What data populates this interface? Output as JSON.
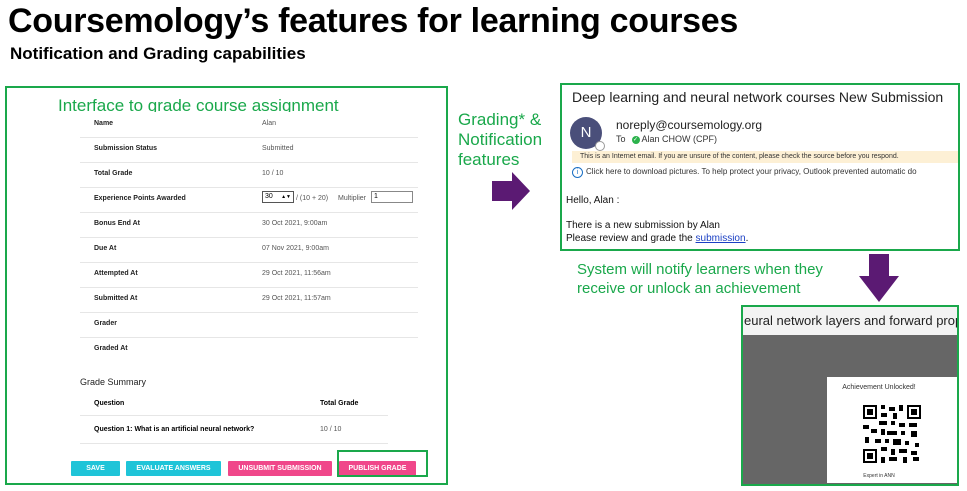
{
  "title": "Coursemology’s features for learning courses",
  "subtitle": "Notification and Grading capabilities",
  "grading_panel": {
    "caption": "Interface to grade course assignment",
    "fields": [
      {
        "label": "Name",
        "value": "Alan"
      },
      {
        "label": "Submission Status",
        "value": "Submitted"
      },
      {
        "label": "Total Grade",
        "value": "10 / 10"
      },
      {
        "label": "Experience Points Awarded",
        "value": ""
      },
      {
        "label": "Bonus End At",
        "value": "30 Oct 2021, 9:00am"
      },
      {
        "label": "Due At",
        "value": "07 Nov 2021, 9:00am"
      },
      {
        "label": "Attempted At",
        "value": "29 Oct 2021, 11:56am"
      },
      {
        "label": "Submitted At",
        "value": "29 Oct 2021, 11:57am"
      },
      {
        "label": "Grader",
        "value": ""
      },
      {
        "label": "Graded At",
        "value": ""
      }
    ],
    "xp_input_value": "30",
    "xp_formula": "/ (10 + 20)",
    "multiplier_label": "Multiplier",
    "multiplier_value": "1",
    "grade_summary": {
      "title": "Grade Summary",
      "headers": {
        "question": "Question",
        "total": "Total Grade"
      },
      "rows": [
        {
          "question": "Question 1: What is an artificial neural network?",
          "grade": "10 / 10"
        }
      ]
    },
    "buttons": {
      "save": "SAVE",
      "evaluate": "EVALUATE ANSWERS",
      "unsubmit": "UNSUBMIT SUBMISSION",
      "publish": "PUBLISH GRADE"
    }
  },
  "middle_caption": {
    "line1": "Grading* &",
    "line2": "Notification",
    "line3": "features"
  },
  "email": {
    "subject": "Deep learning and neural network courses New Submission",
    "avatar_letter": "N",
    "sender": "noreply@coursemology.org",
    "to_label": "To",
    "recipient": "Alan CHOW (CPF)",
    "warning": "This is an Internet email. If you are unsure of the content, please check the source before you respond.",
    "info": "Click here to download pictures. To help protect your privacy, Outlook prevented automatic do",
    "greeting": "Hello, Alan :",
    "body1": "There is a new submission by Alan",
    "body2_prefix": "Please review and grade the ",
    "body2_link": "submission",
    "body2_suffix": "."
  },
  "notify_caption": {
    "line1": "System will notify learners when they",
    "line2": "receive or unlock an achievement"
  },
  "achievement": {
    "video_title": "eural network layers and forward propaga",
    "card_title": "Achievement Unlocked!",
    "card_footer": "Expert in ANN"
  },
  "colors": {
    "accent_green": "#1aa84b",
    "arrow_purple": "#5b1a73",
    "cyan_button": "#1fc4d8",
    "pink_button": "#f0478a"
  }
}
